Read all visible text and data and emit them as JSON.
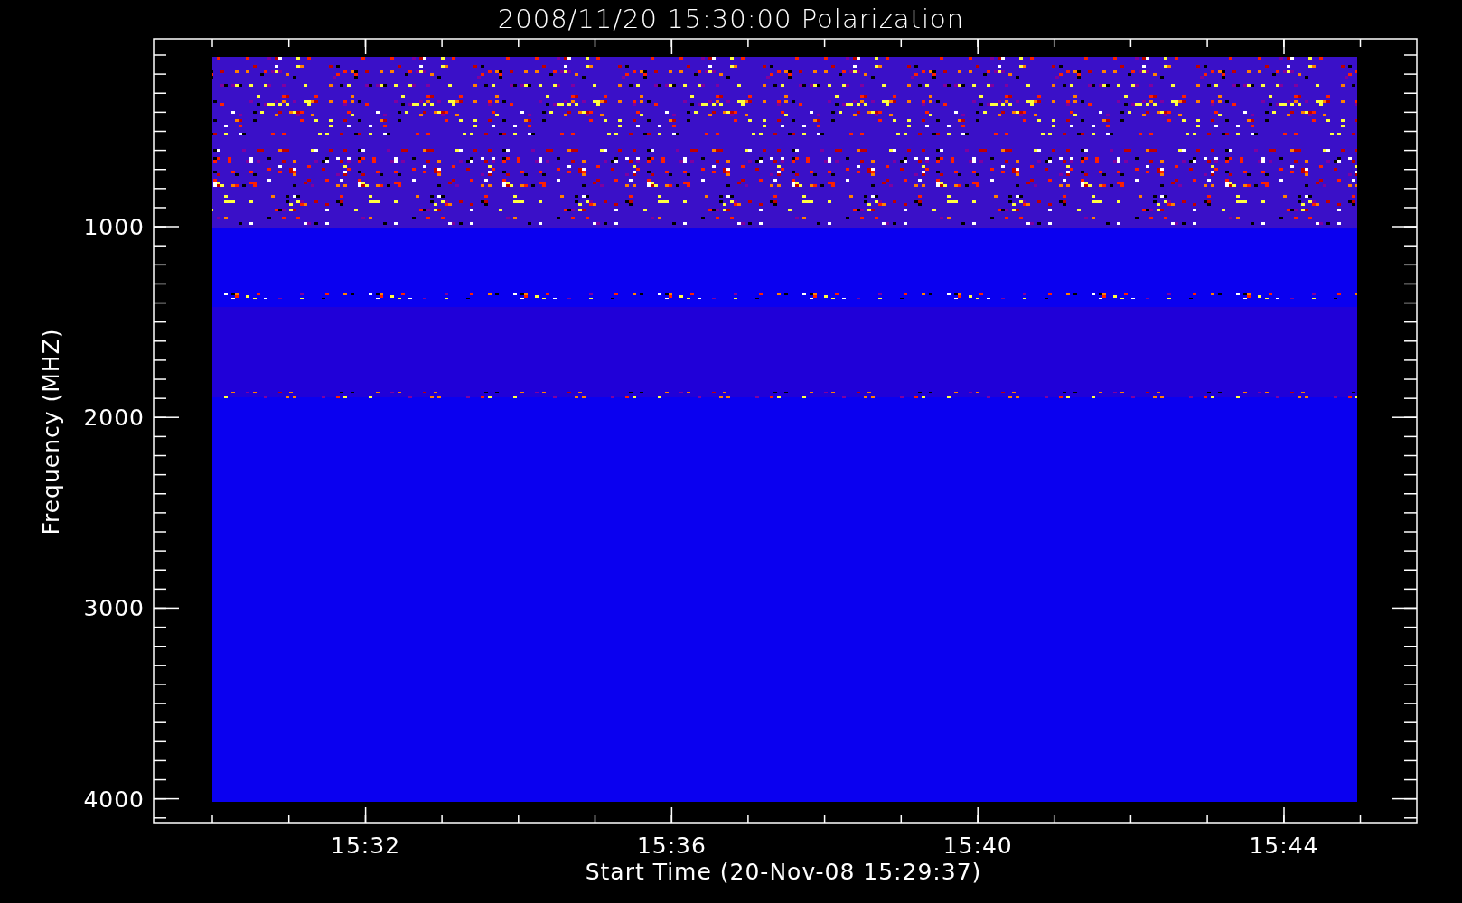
{
  "title": "2008/11/20 15:30:00 Polarization",
  "xlabel": "Start Time (20-Nov-08 15:29:37)",
  "ylabel": "Frequency (MHZ)",
  "xticks": [
    "15:32",
    "15:36",
    "15:40",
    "15:44"
  ],
  "yticks": [
    "1000",
    "2000",
    "3000",
    "4000"
  ]
}
